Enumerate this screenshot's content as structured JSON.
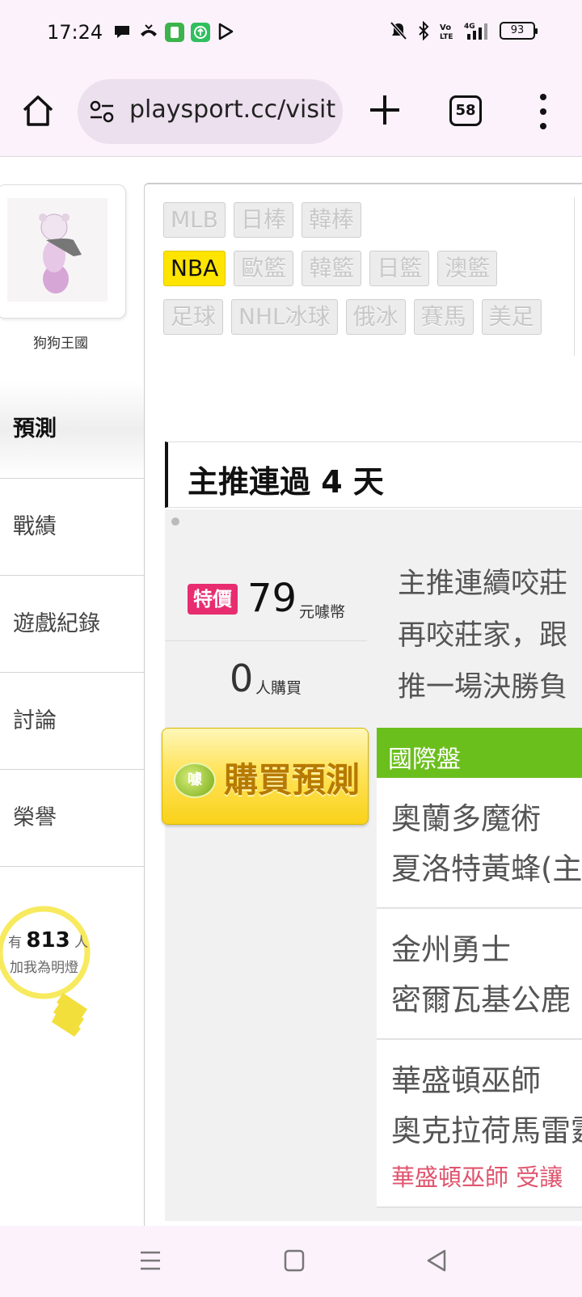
{
  "status_bar": {
    "time": "17:24",
    "battery": "93",
    "notification_icons": [
      "chat-bubble-icon",
      "missed-call-icon",
      "sim-app-icon",
      "green-app-icon",
      "play-store-icon"
    ],
    "system_icons": [
      "mute-icon",
      "bluetooth-icon",
      "volte-icon",
      "4g-signal-icon",
      "battery-icon"
    ]
  },
  "browser": {
    "url": "playsport.cc/visit",
    "tab_count": "58"
  },
  "profile": {
    "username": "狗狗王國"
  },
  "nav": {
    "items": [
      {
        "label": "預測",
        "active": true
      },
      {
        "label": "戰績",
        "active": false
      },
      {
        "label": "遊戲紀錄",
        "active": false
      },
      {
        "label": "討論",
        "active": false
      },
      {
        "label": "榮譽",
        "active": false
      }
    ]
  },
  "fans": {
    "prefix": "有",
    "count": "813",
    "suffix": "人",
    "line2": "加我為明燈"
  },
  "categories": {
    "row1": [
      "MLB",
      "日棒",
      "韓棒"
    ],
    "row2": [
      "NBA",
      "歐籃",
      "韓籃",
      "日籃",
      "澳籃"
    ],
    "row3": [
      "足球",
      "NHL冰球",
      "俄冰",
      "賽馬",
      "美足"
    ],
    "active": "NBA"
  },
  "headline": "主推連過 4 天",
  "offer": {
    "badge": "特價",
    "price": "79",
    "price_unit": "元噱幣",
    "buyers": "0",
    "buyers_unit": "人購買"
  },
  "description_lines": [
    "主推連續咬莊",
    "再咬莊家，跟",
    "推一場決勝負"
  ],
  "buy_button": {
    "coin": "噱",
    "label": "購買預測"
  },
  "odds": {
    "header": "國際盤",
    "matches": [
      {
        "team1": "奧蘭多魔術",
        "team2": "夏洛特黃蜂(主)",
        "note": ""
      },
      {
        "team1": "金州勇士",
        "team2": "密爾瓦基公鹿",
        "note": ""
      },
      {
        "team1": "華盛頓巫師",
        "team2": "奧克拉荷馬雷霆",
        "note": "華盛頓巫師 受讓"
      }
    ]
  },
  "colors": {
    "accent_green": "#6bbf1d",
    "active_category": "#ffe400",
    "price_badge": "#e72d6f",
    "note_red": "#e0556f"
  }
}
